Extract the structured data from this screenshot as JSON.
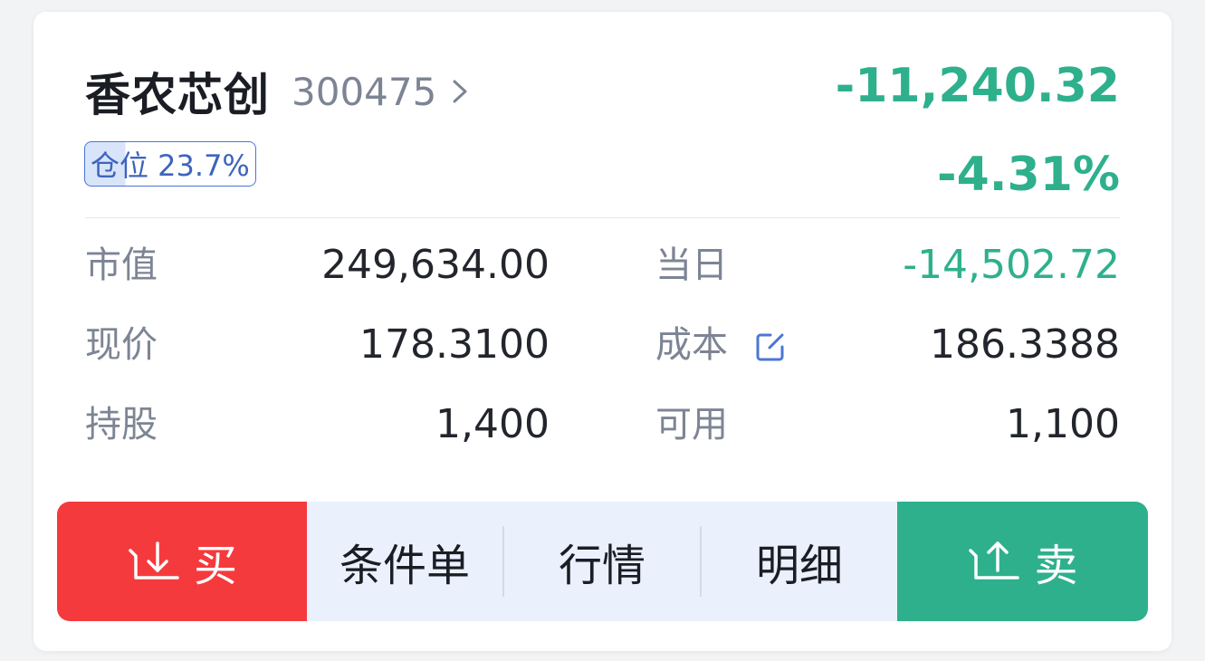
{
  "stock": {
    "name": "香农芯创",
    "code": "300475",
    "pnl_amount": "-11,240.32",
    "pnl_percent": "-4.31%",
    "position_label": "仓位 23.7%",
    "position_ratio": 0.237
  },
  "metrics": {
    "market_value_label": "市值",
    "market_value": "249,634.00",
    "today_label": "当日",
    "today_pnl": "-14,502.72",
    "price_label": "现价",
    "price": "178.3100",
    "cost_label": "成本",
    "cost": "186.3388",
    "shares_label": "持股",
    "shares": "1,400",
    "available_label": "可用",
    "available": "1,100"
  },
  "actions": {
    "buy": "买",
    "conditional_order": "条件单",
    "quote": "行情",
    "detail": "明细",
    "sell": "卖"
  },
  "colors": {
    "loss_green": "#2eb08d",
    "buy_red": "#f53a3d",
    "badge_blue": "#4b76d6",
    "muted": "#7d8494"
  },
  "icons": {
    "chevron": "chevron-right-icon",
    "edit": "edit-icon",
    "buy": "download-arrow-icon",
    "sell": "upload-arrow-icon"
  }
}
